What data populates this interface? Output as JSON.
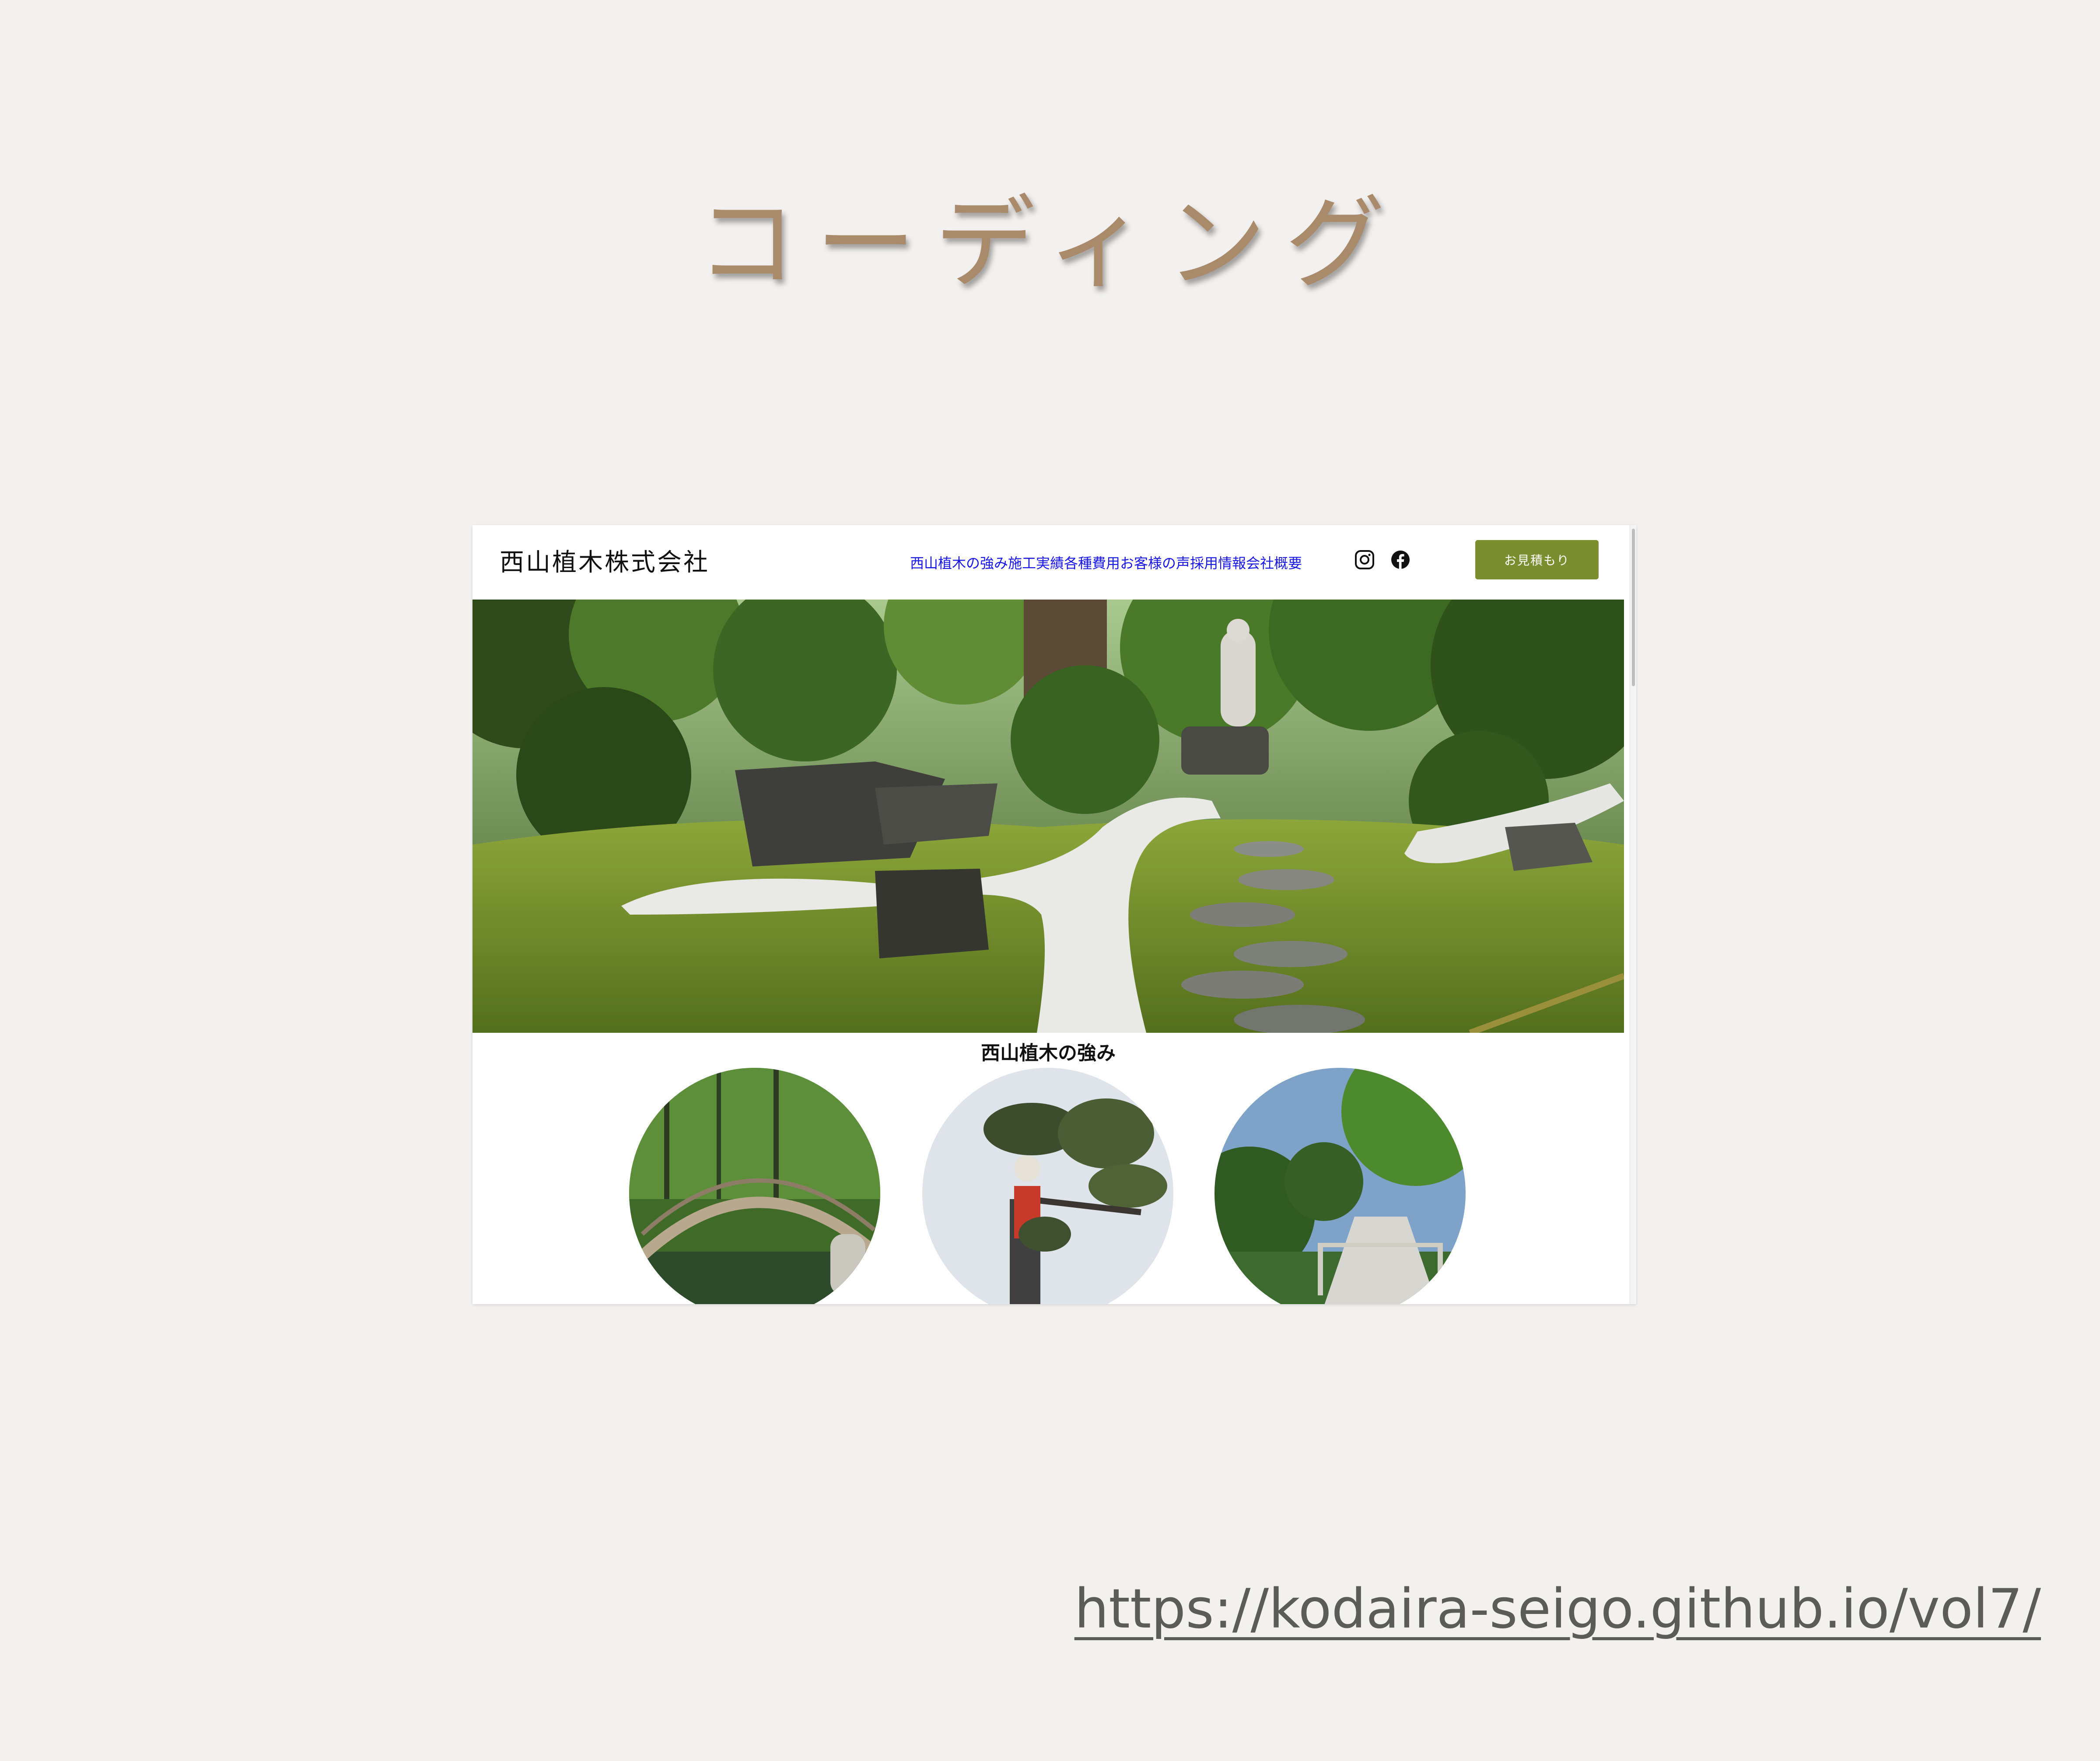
{
  "slide": {
    "title": "コーディング",
    "url": "https://kodaira-seigo.github.io/vol7/"
  },
  "site": {
    "logo": "西山植木株式会社",
    "nav": [
      {
        "label": "西山植木の強み"
      },
      {
        "label": "施工実績"
      },
      {
        "label": "各種費用"
      },
      {
        "label": "お客様の声"
      },
      {
        "label": "採用情報"
      },
      {
        "label": "会社概要"
      }
    ],
    "social_icons": [
      "instagram-icon",
      "facebook-icon"
    ],
    "cta_label": "お見積もり",
    "section_title": "西山植木の強み",
    "colors": {
      "nav_link": "#1a18e0",
      "cta_bg": "#7b8e2f",
      "title_accent": "#a98a6a"
    }
  }
}
